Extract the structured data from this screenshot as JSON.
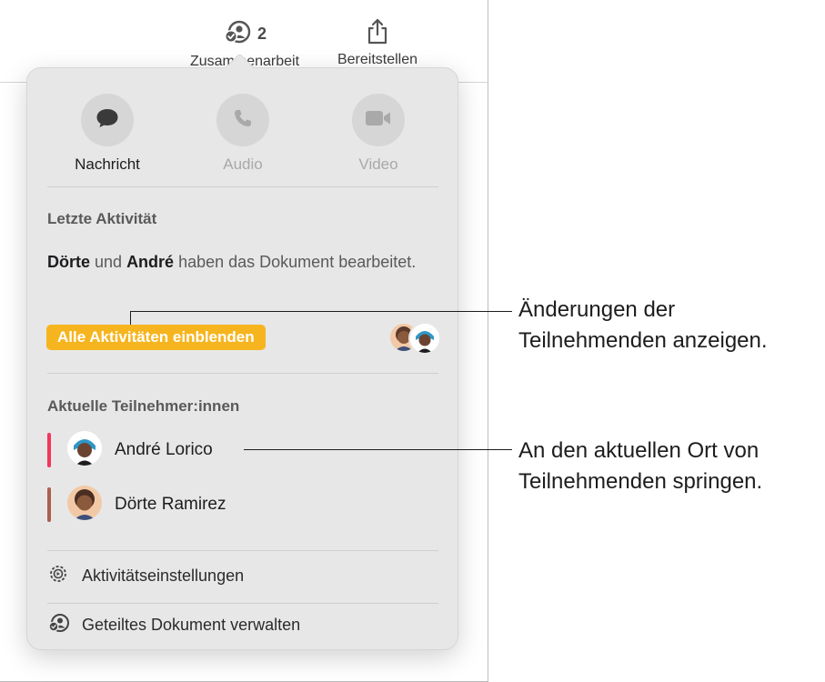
{
  "toolbar": {
    "collaboration_label": "Zusammenarbeit",
    "collaboration_count": "2",
    "share_label": "Bereitstellen"
  },
  "popover": {
    "comm_buttons": [
      {
        "label": "Nachricht",
        "icon": "message-icon",
        "enabled": true
      },
      {
        "label": "Audio",
        "icon": "phone-icon",
        "enabled": false
      },
      {
        "label": "Video",
        "icon": "video-icon",
        "enabled": false
      }
    ],
    "recent_activity": {
      "title": "Letzte Aktivität",
      "person1": "Dörte",
      "conjunction": " und ",
      "person2": "André",
      "text_rest": " haben das Dokument bearbeitet.",
      "show_all_button": "Alle Aktivitäten einblenden"
    },
    "participants": {
      "title": "Aktuelle Teilnehmer:innen",
      "items": [
        {
          "name": "André Lorico",
          "color": "#f2365a"
        },
        {
          "name": "Dörte Ramirez",
          "color": "#a9604e"
        }
      ]
    },
    "menu": [
      {
        "label": "Aktivitätseinstellungen",
        "icon": "activity-settings-icon"
      },
      {
        "label": "Geteiltes Dokument verwalten",
        "icon": "manage-shared-icon"
      }
    ]
  },
  "callouts": [
    {
      "line1": "Änderungen der",
      "line2": "Teilnehmenden anzeigen."
    },
    {
      "line1": "An den aktuellen Ort von",
      "line2": "Teilnehmenden springen."
    }
  ],
  "colors": {
    "accent": "#f6b51f",
    "popover_bg": "#e7e7e7"
  }
}
